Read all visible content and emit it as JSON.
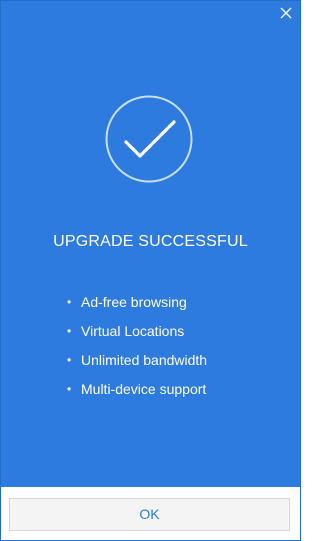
{
  "dialog": {
    "title": "UPGRADE SUCCESSFUL",
    "features": [
      {
        "bullet": "•",
        "label": "Ad-free browsing"
      },
      {
        "bullet": "•",
        "label": "Virtual Locations"
      },
      {
        "bullet": "•",
        "label": "Unlimited bandwidth"
      },
      {
        "bullet": "•",
        "label": "Multi-device support"
      }
    ],
    "ok_label": "OK",
    "icons": {
      "close": "close-icon",
      "success": "checkmark-circle-icon"
    },
    "colors": {
      "panel_background": "#2e7be0",
      "text": "#ffffff",
      "ok_text": "#2e7be0",
      "footer_background": "#ffffff"
    }
  }
}
